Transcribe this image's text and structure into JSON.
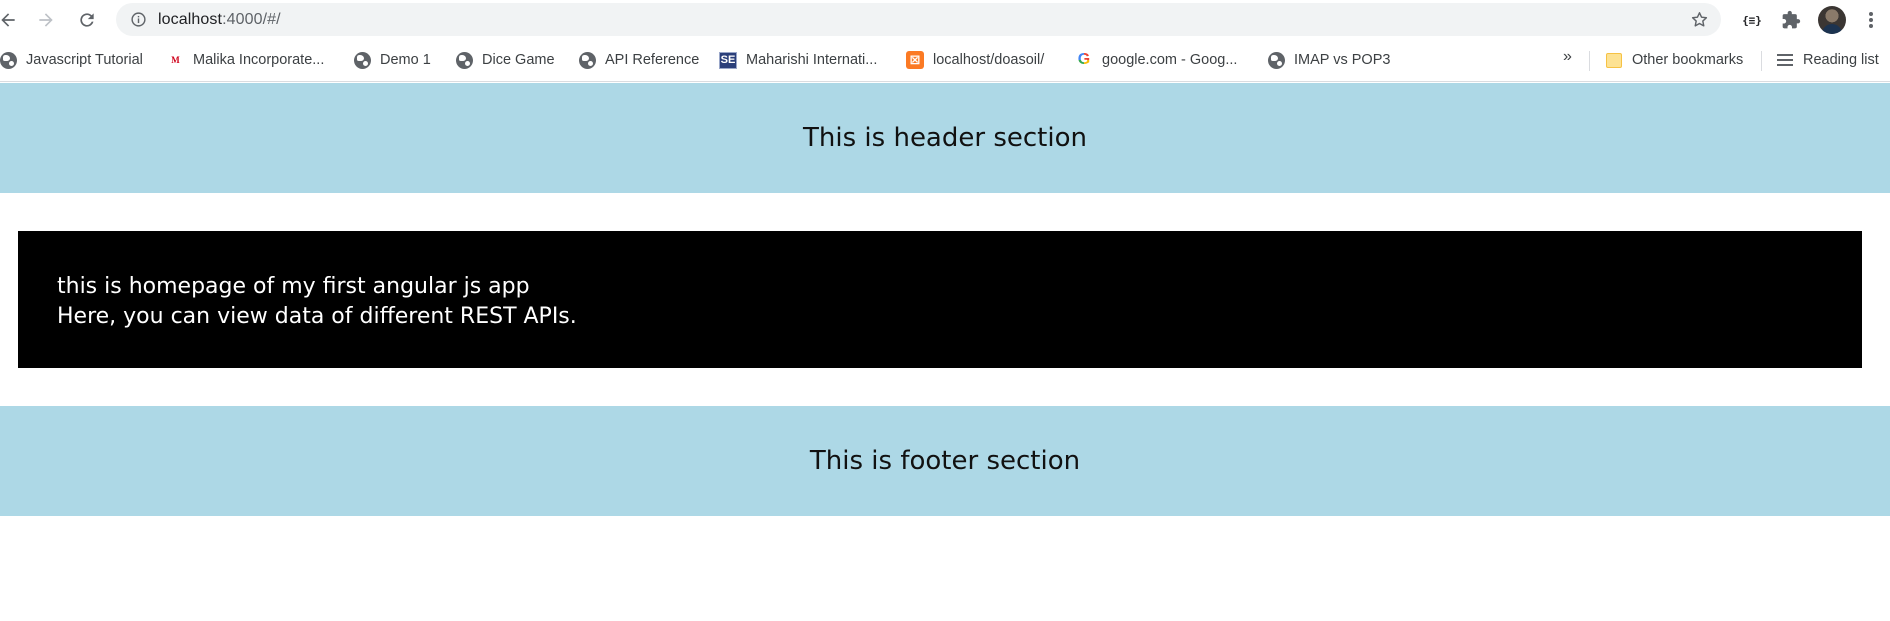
{
  "browser": {
    "url_host": "localhost",
    "url_path": ":4000/#/",
    "bookmarks": [
      {
        "label": "Javascript Tutorial",
        "icon": "globe-icon"
      },
      {
        "label": "Malika Incorporate...",
        "icon": "malika-favicon"
      },
      {
        "label": "Demo 1",
        "icon": "globe-icon"
      },
      {
        "label": "Dice Game",
        "icon": "globe-icon"
      },
      {
        "label": "API Reference",
        "icon": "globe-icon"
      },
      {
        "label": "Maharishi Internati...",
        "icon": "se-favicon"
      },
      {
        "label": "localhost/doasoil/",
        "icon": "xampp-favicon"
      },
      {
        "label": "google.com - Goog...",
        "icon": "google-favicon"
      },
      {
        "label": "IMAP vs POP3",
        "icon": "globe-icon"
      }
    ],
    "overflow_label": "»",
    "other_bookmarks_label": "Other bookmarks",
    "reading_list_label": "Reading list",
    "extension_json_label": "{≡}",
    "favicon_malika_text": "M",
    "favicon_se_text": "SE",
    "favicon_xampp_text": "⊠",
    "favicon_google_text": "G"
  },
  "page": {
    "header_text": "This is header section",
    "main_line1": "this is homepage of my first angular js app",
    "main_line2": "Here, you can view data of different REST APIs.",
    "footer_text": "This is footer section",
    "colors": {
      "header_bg": "#add8e6",
      "main_bg": "#000000",
      "main_text": "#ffffff",
      "footer_bg": "#add8e6"
    }
  }
}
